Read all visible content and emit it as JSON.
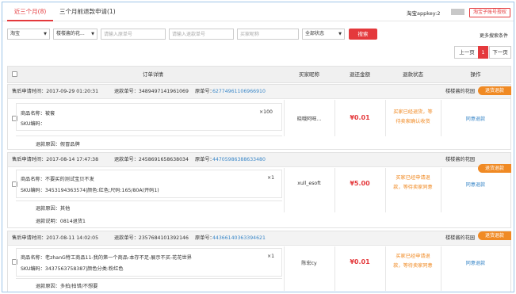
{
  "tabs": [
    {
      "label": "近三个月(8)",
      "active": true
    },
    {
      "label": "三个月前退款申请(1)",
      "active": false
    }
  ],
  "header": {
    "appkey_label": "淘宝appkey:2",
    "auth_button": "淘宝子账号授权"
  },
  "filters": {
    "platform": "淘宝",
    "shop": "楼楼酱的花...",
    "refund_id_placeholder": "请输入原单号",
    "return_no_placeholder": "请输入退款单号",
    "buyer_placeholder": "买家昵称",
    "status": "全部状态",
    "search_button": "搜索",
    "more_conditions": "更多搜索条件"
  },
  "pager": {
    "prev": "上一页",
    "current": "1",
    "next": "下一页"
  },
  "table_headers": [
    "订单详情",
    "买家昵称",
    "退还金额",
    "退款状态",
    "操作"
  ],
  "orders": [
    {
      "apply_time": "售后申请时间：2017-09-29 01:20:31",
      "refund_no": "退款单号：3489497141961069",
      "orig_no_label": "原单号：",
      "orig_no": "62774961106966910",
      "shop": "楼楼酱的花园",
      "ribbon": "退货退款",
      "product_name": "商品名称：被套",
      "sku": "SKU编码：",
      "qty": "×100",
      "buyer": "晓哦阿旺...",
      "amount": "¥0.01",
      "status_lines": [
        "买家已经退货，等",
        "待卖家确认收货"
      ],
      "action": "同意退款",
      "reason": "退款原因：假冒品牌",
      "note": ""
    },
    {
      "apply_time": "售后申请时间：2017-08-14 17:47:38",
      "refund_no": "退款单号：2458691658638034",
      "orig_no_label": "原单号：",
      "orig_no": "44705986388633480",
      "shop": "楼楼酱的花园",
      "ribbon": "退货退款",
      "product_name": "商品名称：不要买的测试宝贝不发",
      "sku": "SKU编码：3453194363574|颜色:红色;尺码:165/80A(开码1)",
      "qty": "×1",
      "buyer": "xull_esoft",
      "amount": "¥5.00",
      "status_lines": [
        "买家已经申请退",
        "款，等待卖家同意"
      ],
      "action": "同意退款",
      "reason": "退款原因：其他",
      "note": "退款说明：0814退货1"
    },
    {
      "apply_time": "售后申请时间：2017-08-11 14:02:05",
      "refund_no": "退款单号：2357684101392146",
      "orig_no_label": "原单号：",
      "orig_no": "44366140363394621",
      "shop": "楼楼酱的花园",
      "ribbon": "退货退款",
      "product_name": "商品名称：老zhanG特工商品11-我的第一个商品-本存不足-展示不买-花花世界",
      "sku": "SKU编码：3437563758387|颜色分类:粉红色",
      "qty": "×1",
      "buyer": "陈宏cy",
      "amount": "¥0.01",
      "status_lines": [
        "买家已经申请退",
        "款，等待卖家同意"
      ],
      "action": "同意退款",
      "reason": "退款原因：多拍/拍错/不想要",
      "note": ""
    }
  ],
  "colors": {
    "accent": "#e4393c",
    "link": "#3a87c8",
    "ribbon": "#f08a24"
  }
}
